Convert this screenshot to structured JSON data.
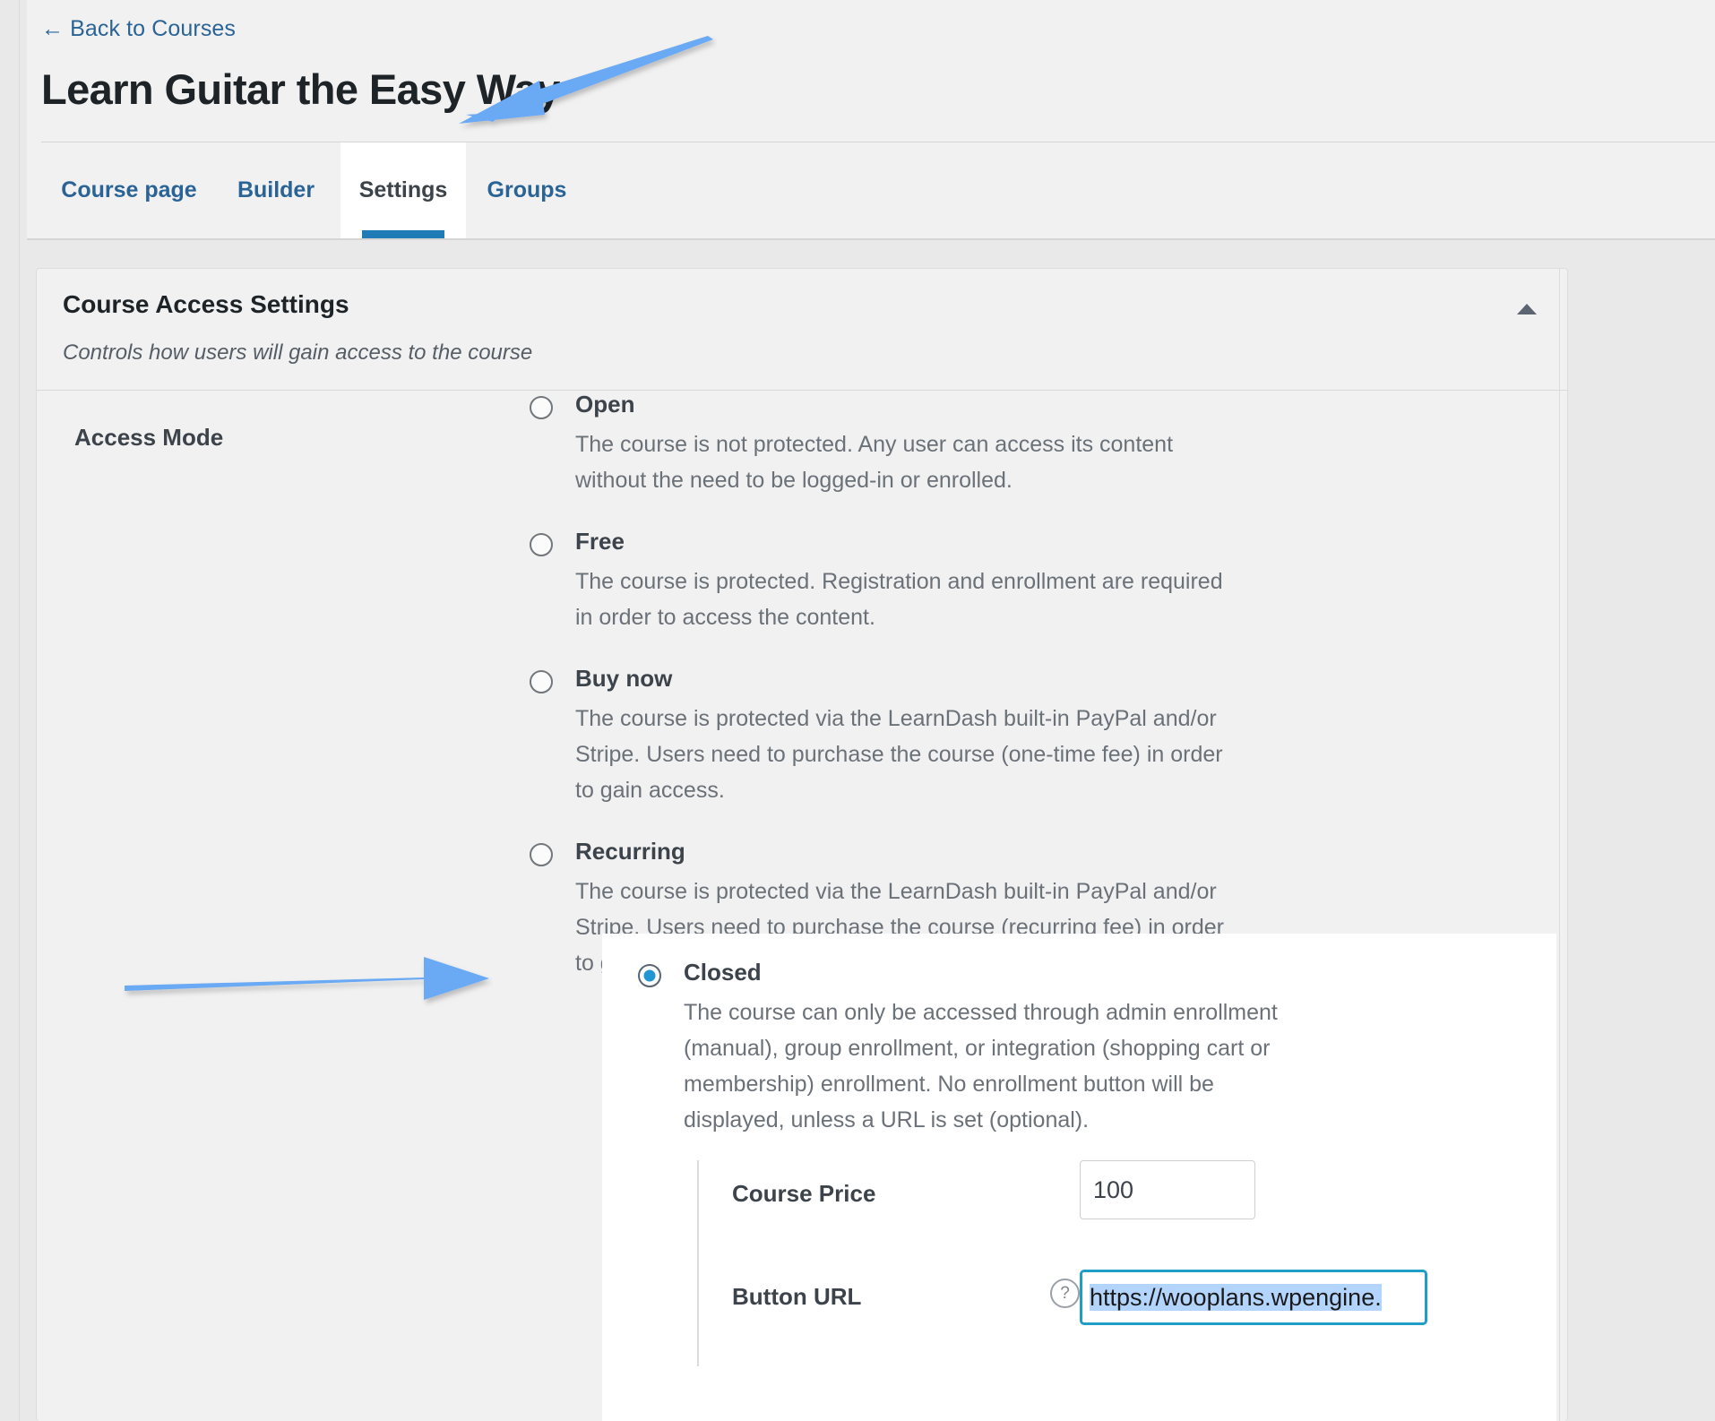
{
  "header": {
    "back_link": "Back to Courses",
    "back_arrow_icon": "arrow-left-icon",
    "title": "Learn Guitar the Easy Way",
    "tabs": [
      {
        "label": "Course page",
        "active": false
      },
      {
        "label": "Builder",
        "active": false
      },
      {
        "label": "Settings",
        "active": true
      },
      {
        "label": "Groups",
        "active": false
      }
    ]
  },
  "panel": {
    "title": "Course Access Settings",
    "subtitle": "Controls how users will gain access to the course",
    "collapse_icon": "triangle-up-icon"
  },
  "access_mode": {
    "label": "Access Mode",
    "selected": "closed",
    "options": [
      {
        "id": "open",
        "label": "Open",
        "description": "The course is not protected. Any user can access its content without the need to be logged-in or enrolled.",
        "checked": false
      },
      {
        "id": "free",
        "label": "Free",
        "description": "The course is protected. Registration and enrollment are required in order to access the content.",
        "checked": false
      },
      {
        "id": "buy-now",
        "label": "Buy now",
        "description": "The course is protected via the LearnDash built-in PayPal and/or Stripe. Users need to purchase the course (one-time fee) in order to gain access.",
        "checked": false
      },
      {
        "id": "recurring",
        "label": "Recurring",
        "description": "The course is protected via the LearnDash built-in PayPal and/or Stripe. Users need to purchase the course (recurring fee) in order to gain access.",
        "checked": false
      }
    ],
    "closed_option": {
      "id": "closed",
      "label": "Closed",
      "description": "The course can only be accessed through admin enrollment (manual), group enrollment, or integration (shopping cart or membership) enrollment. No enrollment button will be displayed, unless a URL is set (optional).",
      "checked": true
    }
  },
  "subfields": {
    "course_price": {
      "label": "Course Price",
      "value": "100",
      "placeholder": ""
    },
    "button_url": {
      "label": "Button URL",
      "help_icon": "question-mark-icon",
      "help_glyph": "?",
      "value": "https://wooplans.wpengine.",
      "placeholder": "",
      "selected": true,
      "focused": true
    }
  },
  "annotations": {
    "arrow_top": {
      "name": "annotation-arrow-to-settings-tab",
      "color": "#6aa9f4"
    },
    "arrow_mid": {
      "name": "annotation-arrow-to-closed-option",
      "color": "#6aa9f4"
    }
  },
  "colors": {
    "link": "#2a6496",
    "accent": "#1f7bb6",
    "radio_accent": "#2196d3",
    "focus_border": "#1f9cc8",
    "selection": "#b3d4fd",
    "arrow": "#6aa9f4",
    "page_bg": "#e9e9e9",
    "panel_bg": "#f1f1f1"
  }
}
